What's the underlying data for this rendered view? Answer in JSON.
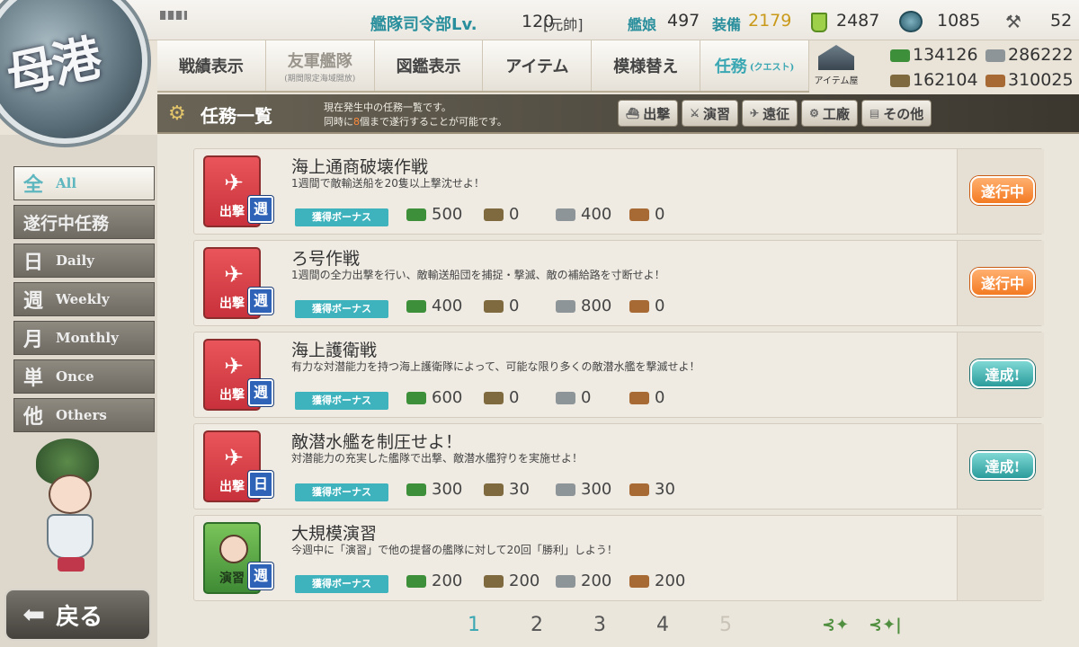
{
  "topbar": {
    "hq_label": "艦隊司令部Lv.",
    "level": "120",
    "rank": "[元帥]",
    "ships_label": "艦娘",
    "ships_count": "497",
    "equip_label": "装備",
    "equip_count": "2179",
    "buckets": "2487",
    "dev_materials": "1085",
    "improve_materials": "52"
  },
  "logo_text": "母港",
  "nav": {
    "items": [
      {
        "label": "戦績表示"
      },
      {
        "label": "友軍艦隊",
        "sub": "(期間限定海域開放)"
      },
      {
        "label": "図鑑表示"
      },
      {
        "label": "アイテム"
      },
      {
        "label": "模様替え"
      },
      {
        "label": "任務",
        "sub": "(クエスト)"
      }
    ],
    "shop_label": "アイテム屋"
  },
  "resources": {
    "fuel": "134126",
    "steel": "286222",
    "ammo": "162104",
    "bauxite": "310025"
  },
  "header": {
    "title": "任務一覧",
    "desc1": "現在発生中の任務一覧です。",
    "desc2_pre": "同時に",
    "desc2_num": "8",
    "desc2_post": "個まで遂行することが可能です。",
    "filters": [
      "出撃",
      "演習",
      "遠征",
      "工廠",
      "その他"
    ]
  },
  "sidebar": {
    "categories": [
      {
        "kanji": "全",
        "en": "All"
      },
      {
        "label": "遂行中任務"
      },
      {
        "kanji": "日",
        "en": "Daily"
      },
      {
        "kanji": "週",
        "en": "Weekly"
      },
      {
        "kanji": "月",
        "en": "Monthly"
      },
      {
        "kanji": "単",
        "en": "Once"
      },
      {
        "kanji": "他",
        "en": "Others"
      }
    ],
    "back_label": "戻る"
  },
  "quests": [
    {
      "type": "出撃",
      "freq": "週",
      "title": "海上通商破壊作戦",
      "desc": "1週間で敵輸送船を20隻以上撃沈せよ！",
      "bonus": "獲得ボーナス",
      "fuel": "500",
      "ammo": "0",
      "steel": "400",
      "baux": "0",
      "status": "遂行中"
    },
    {
      "type": "出撃",
      "freq": "週",
      "title": "ろ号作戦",
      "desc": "1週間の全力出撃を行い、敵輸送船団を捕捉・撃滅、敵の補給路を寸断せよ！",
      "bonus": "獲得ボーナス",
      "fuel": "400",
      "ammo": "0",
      "steel": "800",
      "baux": "0",
      "status": "遂行中"
    },
    {
      "type": "出撃",
      "freq": "週",
      "title": "海上護衛戦",
      "desc": "有力な対潜能力を持つ海上護衛隊によって、可能な限り多くの敵潜水艦を撃滅せよ！",
      "bonus": "獲得ボーナス",
      "fuel": "600",
      "ammo": "0",
      "steel": "0",
      "baux": "0",
      "status": "達成!"
    },
    {
      "type": "出撃",
      "freq": "日",
      "title": "敵潜水艦を制圧せよ！",
      "desc": "対潜能力の充実した艦隊で出撃、敵潜水艦狩りを実施せよ！",
      "bonus": "獲得ボーナス",
      "fuel": "300",
      "ammo": "30",
      "steel": "300",
      "baux": "30",
      "status": "達成!"
    },
    {
      "type": "演習",
      "freq": "週",
      "title": "大規模演習",
      "desc": "今週中に「演習」で他の提督の艦隊に対して20回「勝利」しよう！",
      "bonus": "獲得ボーナス",
      "fuel": "200",
      "ammo": "200",
      "steel": "200",
      "baux": "200",
      "status": ""
    }
  ],
  "pager": {
    "pages": [
      "1",
      "2",
      "3",
      "4",
      "5"
    ],
    "current": "1"
  },
  "colors": {
    "accent": "#3aa7b3",
    "in_progress": "#f37a22",
    "complete": "#2a9c9c",
    "sortie_icon": "#d23a44",
    "exercise_icon": "#4f9a3f"
  },
  "icons": {
    "fuel": "fuel-drum-icon",
    "ammo": "ammo-icon",
    "steel": "steel-ingot-icon",
    "bauxite": "bauxite-icon",
    "bucket": "repair-bucket-icon",
    "dev_material": "dev-material-icon",
    "improve_material": "improve-material-icon"
  }
}
